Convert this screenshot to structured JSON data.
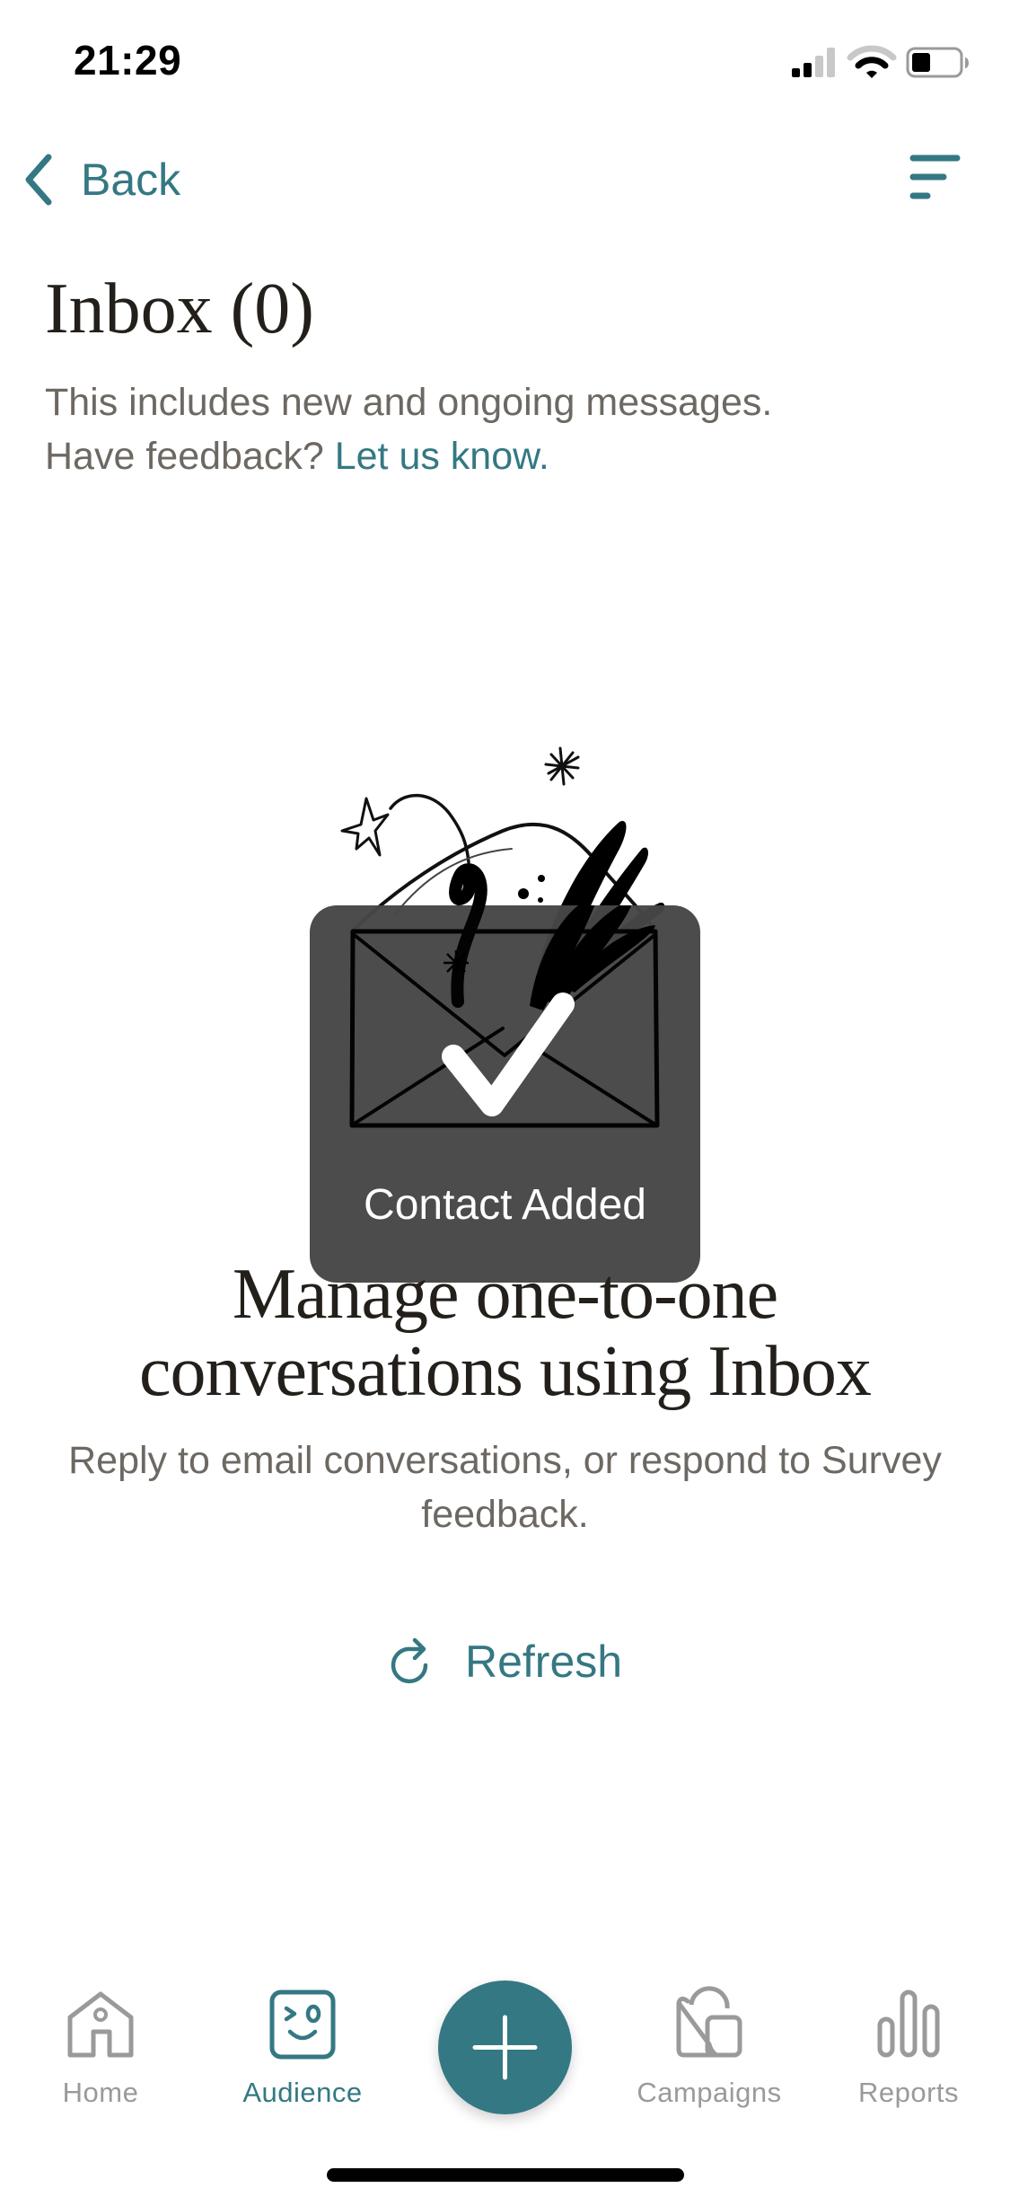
{
  "status_bar": {
    "time": "21:29",
    "signal_bars_active": 2,
    "signal_bars_total": 4,
    "wifi_arcs_active": 2,
    "wifi_arcs_total": 3,
    "battery_level": 0.4,
    "icons": [
      "signal-icon",
      "wifi-icon",
      "battery-icon"
    ]
  },
  "nav": {
    "back_label": "Back",
    "back_icon": "chevron-left-icon",
    "filter_icon": "filter-icon"
  },
  "header": {
    "title": "Inbox (0)",
    "subtitle_line1": "This includes new and ongoing messages.",
    "feedback_prompt": "Have feedback?",
    "feedback_link": "Let us know."
  },
  "empty_state": {
    "illustration": "envelope-illustration",
    "heading": "Manage one-to-one conversations using Inbox",
    "body": "Reply to email conversations, or respond to Survey feedback.",
    "refresh_label": "Refresh",
    "refresh_icon": "refresh-icon"
  },
  "toast": {
    "icon": "checkmark-icon",
    "message": "Contact Added"
  },
  "tab_bar": {
    "tabs": [
      {
        "label": "Home",
        "icon": "home-icon",
        "active": false
      },
      {
        "label": "Audience",
        "icon": "audience-icon",
        "active": true
      },
      {
        "label": "Campaigns",
        "icon": "campaigns-icon",
        "active": false
      },
      {
        "label": "Reports",
        "icon": "reports-icon",
        "active": false
      }
    ],
    "fab_icon": "plus-icon"
  },
  "colors": {
    "accent": "#347883",
    "text_dark": "#231f1a",
    "text_muted": "#6d6862",
    "tab_inactive": "#9a9a9a",
    "toast_bg": "#464646"
  }
}
